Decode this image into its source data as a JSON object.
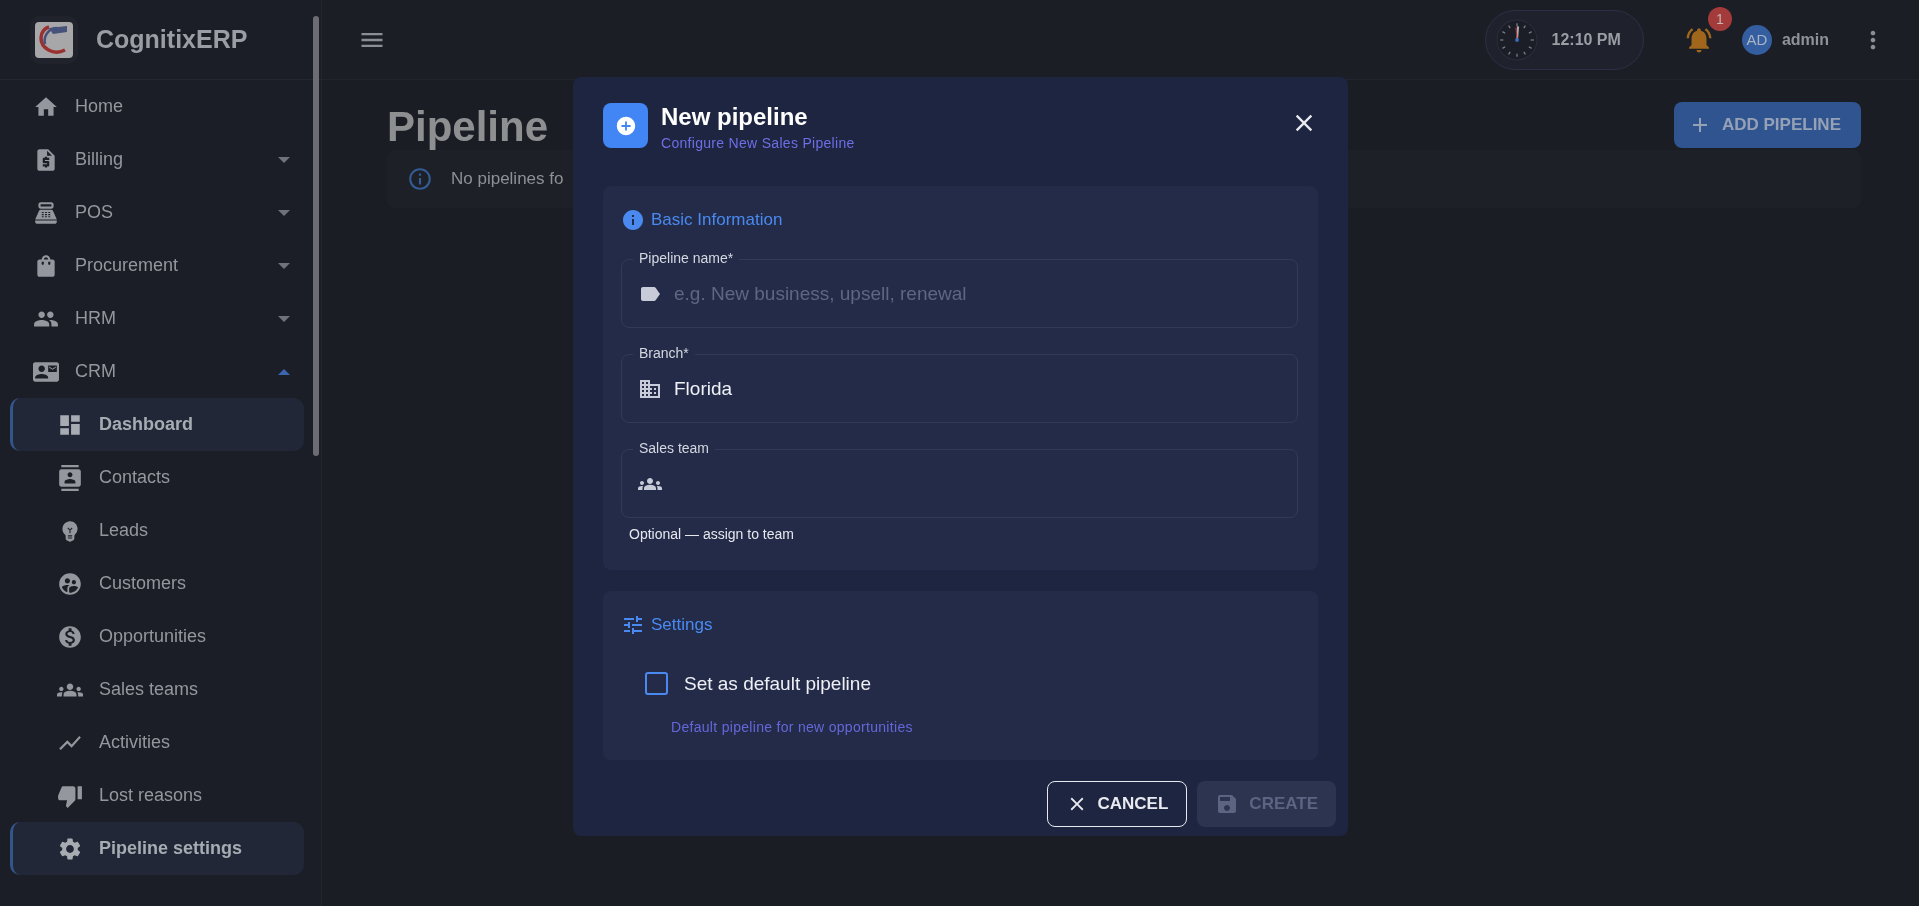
{
  "app": {
    "name": "CognitixERP"
  },
  "sidebar": {
    "items": [
      {
        "label": "Home",
        "kind": "link",
        "selected": false
      },
      {
        "label": "Billing",
        "kind": "group",
        "expanded": false,
        "selected": false
      },
      {
        "label": "POS",
        "kind": "group",
        "expanded": false,
        "selected": false
      },
      {
        "label": "Procurement",
        "kind": "group",
        "expanded": false,
        "selected": false
      },
      {
        "label": "HRM",
        "kind": "group",
        "expanded": false,
        "selected": false
      },
      {
        "label": "CRM",
        "kind": "group",
        "expanded": true,
        "selected": false,
        "children": [
          {
            "label": "Dashboard",
            "selected": true
          },
          {
            "label": "Contacts",
            "selected": false
          },
          {
            "label": "Leads",
            "selected": false
          },
          {
            "label": "Customers",
            "selected": false
          },
          {
            "label": "Opportunities",
            "selected": false
          },
          {
            "label": "Sales teams",
            "selected": false
          },
          {
            "label": "Activities",
            "selected": false
          },
          {
            "label": "Lost reasons",
            "selected": false
          },
          {
            "label": "Pipeline settings",
            "selected": true
          }
        ]
      }
    ]
  },
  "header": {
    "clock": "12:10 PM",
    "notifications": "1",
    "avatar": "AD",
    "user": "admin"
  },
  "page": {
    "title": "Pipeline",
    "alert": "No pipelines fo",
    "add_button": "ADD PIPELINE"
  },
  "dialog": {
    "title": "New pipeline",
    "subtitle": "Configure New Sales Pipeline",
    "basic": {
      "title": "Basic Information",
      "fields": [
        {
          "label": "Pipeline name*",
          "placeholder": "e.g. New business, upsell, renewal"
        },
        {
          "label": "Branch*",
          "value": "Florida"
        },
        {
          "label": "Sales team",
          "helper": "Optional — assign to team"
        }
      ]
    },
    "settings": {
      "title": "Settings",
      "checkbox": {
        "label": "Set as default pipeline",
        "checked": false,
        "helper": "Default pipeline for new opportunities"
      }
    },
    "buttons": {
      "cancel": {
        "label": "CANCEL"
      },
      "create": {
        "label": "CREATE",
        "disabled": true
      }
    }
  }
}
